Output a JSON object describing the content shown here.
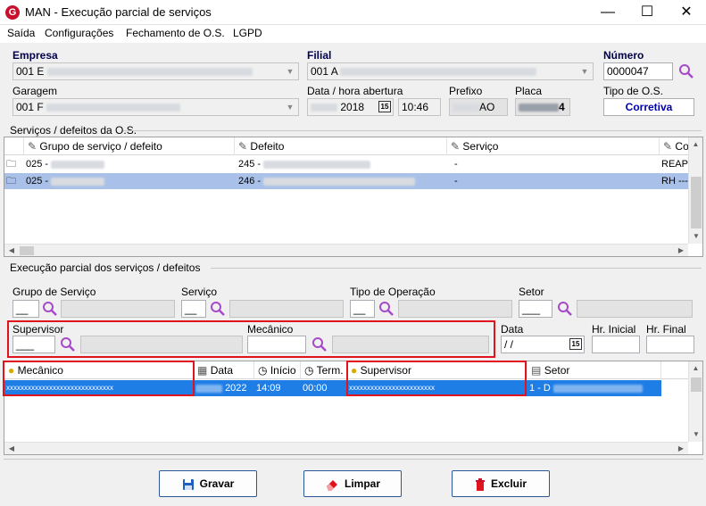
{
  "window": {
    "title": "MAN - Execução parcial de serviços",
    "app_icon_letter": "G",
    "minimize": "—",
    "maximize": "☐",
    "close": "✕"
  },
  "menu": [
    "Saída",
    "Configurações",
    "Fechamento de O.S.",
    "LGPD"
  ],
  "header": {
    "empresa_label": "Empresa",
    "empresa_value": "001 E",
    "filial_label": "Filial",
    "filial_value": "001 A",
    "numero_label": "Número",
    "numero_value": "0000047",
    "garagem_label": "Garagem",
    "garagem_value": "001 F",
    "data_abertura_label": "Data / hora abertura",
    "data_abertura_date": "2018",
    "data_abertura_time": "10:46",
    "prefixo_label": "Prefixo",
    "prefixo_value": "AO",
    "placa_label": "Placa",
    "placa_value": "4",
    "tipo_os_label": "Tipo de O.S.",
    "tipo_os_value": "Corretiva"
  },
  "servicos_section": {
    "title": "Serviços / defeitos da O.S.",
    "columns": [
      "Grupo de serviço / defeito",
      "Defeito",
      "Serviço",
      "Co"
    ],
    "rows": [
      {
        "grupo": "025 -",
        "defeito": "245 -",
        "servico": "-",
        "co": "REAPI"
      },
      {
        "grupo": "025 -",
        "defeito": "246 -",
        "servico": "-",
        "co": "RH ----"
      }
    ]
  },
  "execucao_section": {
    "title": "Execução parcial dos serviços / defeitos",
    "grupo_servico_label": "Grupo de Serviço",
    "servico_label": "Serviço",
    "tipo_operacao_label": "Tipo de Operação",
    "setor_label": "Setor",
    "supervisor_label": "Supervisor",
    "mecanico_label": "Mecânico",
    "data_label": "Data",
    "data_value": " /  /",
    "hr_inicial_label": "Hr. Inicial",
    "hr_final_label": "Hr. Final",
    "grid_columns": [
      "Mecânico",
      "Data",
      "Início",
      "Term.",
      "Supervisor",
      "Setor"
    ],
    "grid_rows": [
      {
        "mecanico": "xxxxxxxxxxxxxxxxxxxxxxxxxxxxxx",
        "data": "2022",
        "inicio": "14:09",
        "term": "00:00",
        "supervisor": "xxxxxxxxxxxxxxxxxxxxxxxx",
        "setor": "1 - D"
      }
    ]
  },
  "buttons": {
    "gravar": "Gravar",
    "limpar": "Limpar",
    "excluir": "Excluir"
  },
  "colors": {
    "accent_blue": "#2b5797",
    "selection": "#1e7ee6",
    "highlight_red": "#e0141e",
    "title_blue": "#0000aa"
  }
}
